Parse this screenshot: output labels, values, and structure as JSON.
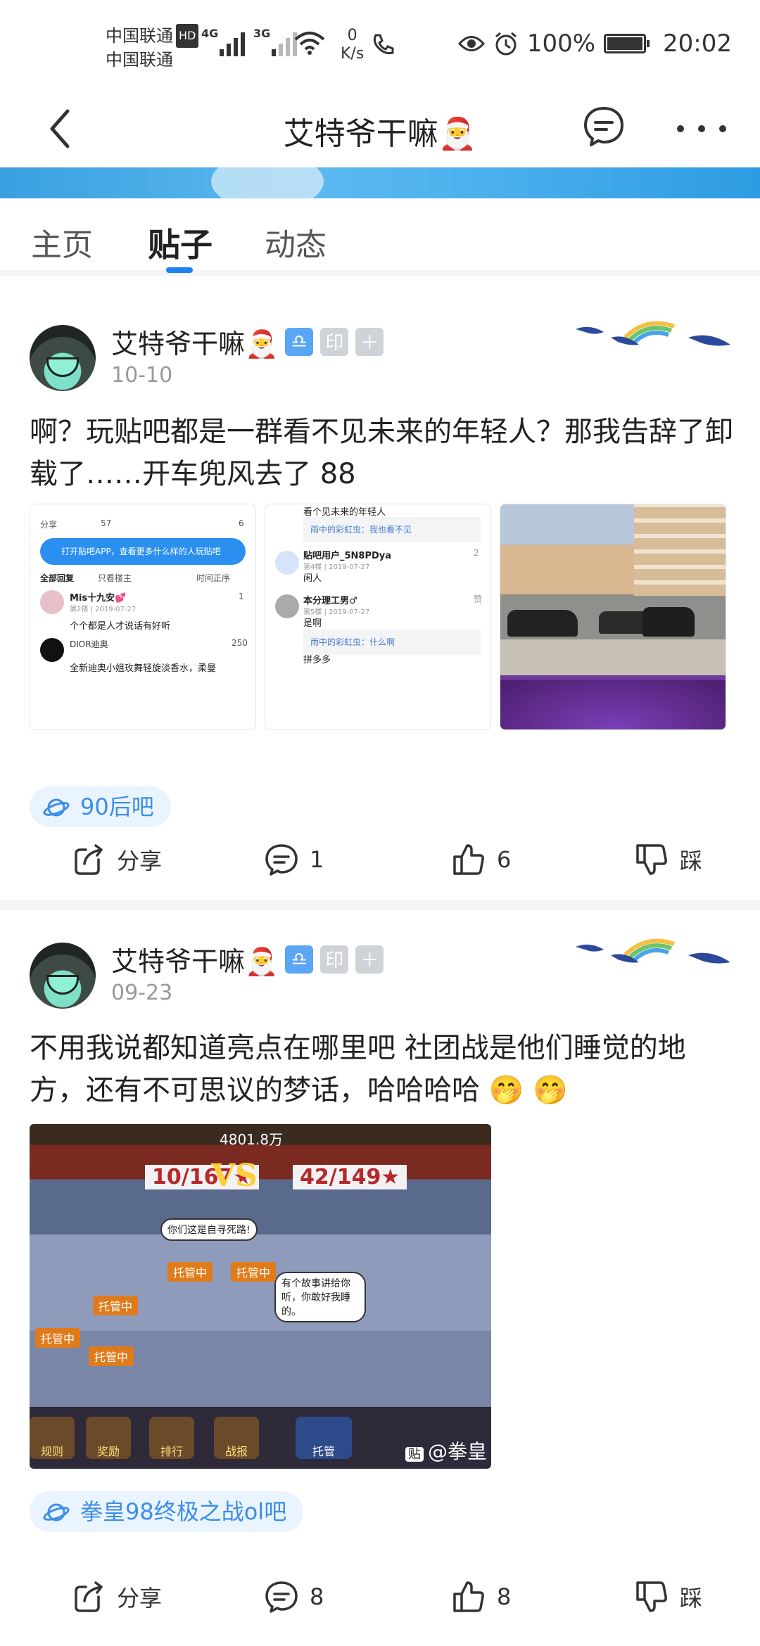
{
  "status_bar": {
    "carrier1": "中国联通",
    "hd": "HD",
    "carrier2": "中国联通",
    "net1": "4G",
    "net2": "3G",
    "speed_value": "0",
    "speed_unit": "K/s",
    "battery": "100%",
    "time": "20:02"
  },
  "title_bar": {
    "title": "艾特爷干嘛🎅"
  },
  "tabs": [
    {
      "label": "主页"
    },
    {
      "label": "贴子"
    },
    {
      "label": "动态"
    }
  ],
  "active_tab": 1,
  "posts": [
    {
      "author": "艾特爷干嘛🎅",
      "badge2": "印",
      "badge3": "＋",
      "date": "10-10",
      "text": "啊？玩贴吧都是一群看不见未来的年轻人？那我告辞了卸载了……开车兜风去了 88",
      "thumb1": {
        "share": "分享",
        "comments": "57",
        "likes": "6",
        "banner": "打开贴吧APP，查看更多什么样的人玩贴吧",
        "all_replies": "全部回复",
        "only_op": "只看楼主",
        "order": "时间正序",
        "user1": "Mis十九安💕",
        "user1_meta": "第2楼 | 2019-07-27",
        "user1_likes": "1",
        "user1_text": "个个都是人才说话有好听",
        "user2": "DIOR迪奥",
        "user2_likes": "250",
        "user2_text": "全新迪奥小姐玫舞轻旋淡香水，柔曼"
      },
      "thumb2": {
        "top_text": "看个见未来的年轻人",
        "quote1": "雨中的彩虹虫：我也看不见",
        "user1": "贴吧用户_5N8PDya",
        "user1_meta": "第4楼 | 2019-07-27",
        "user1_likes": "2",
        "user1_text": "闲人",
        "user2": "本分理工男♂",
        "user2_meta": "第5楼 | 2019-07-27",
        "user2_likes": "赞",
        "user2_text": "是啊",
        "quote2": "雨中的彩虹虫：什么啊",
        "user3": "拼多多"
      },
      "forum": "90后吧",
      "actions": {
        "share": "分享",
        "comments": "1",
        "likes": "6",
        "dislike": "踩"
      }
    },
    {
      "author": "艾特爷干嘛🎅",
      "badge2": "印",
      "badge3": "＋",
      "date": "09-23",
      "text": "不用我说都知道亮点在哪里吧 社团战是他们睡觉的地方，还有不可思议的梦话，哈哈哈哈 🤭 🤭",
      "game": {
        "gold": "4801.8万",
        "vs": "VS",
        "left_score": "10/167★",
        "right_score": "42/149★",
        "bubble1": "你们这是自寻死路!",
        "bubble2": "有个故事讲给你听，你敢好我睡的。",
        "tag": "托管中",
        "btn1": "规则",
        "btn2": "奖励",
        "btn3": "排行",
        "btn4": "战报",
        "btn5": "托管",
        "watermark_badge": "贴",
        "watermark": "@拳皇"
      },
      "forum": "拳皇98终极之战ol吧",
      "actions": {
        "share": "分享",
        "comments": "8",
        "likes": "8",
        "dislike": "踩"
      }
    }
  ],
  "colors": {
    "accent": "#2080f0",
    "forum_bg": "#eaf4ff",
    "forum_text": "#3c8de6",
    "separator": "#f4f5f7"
  }
}
